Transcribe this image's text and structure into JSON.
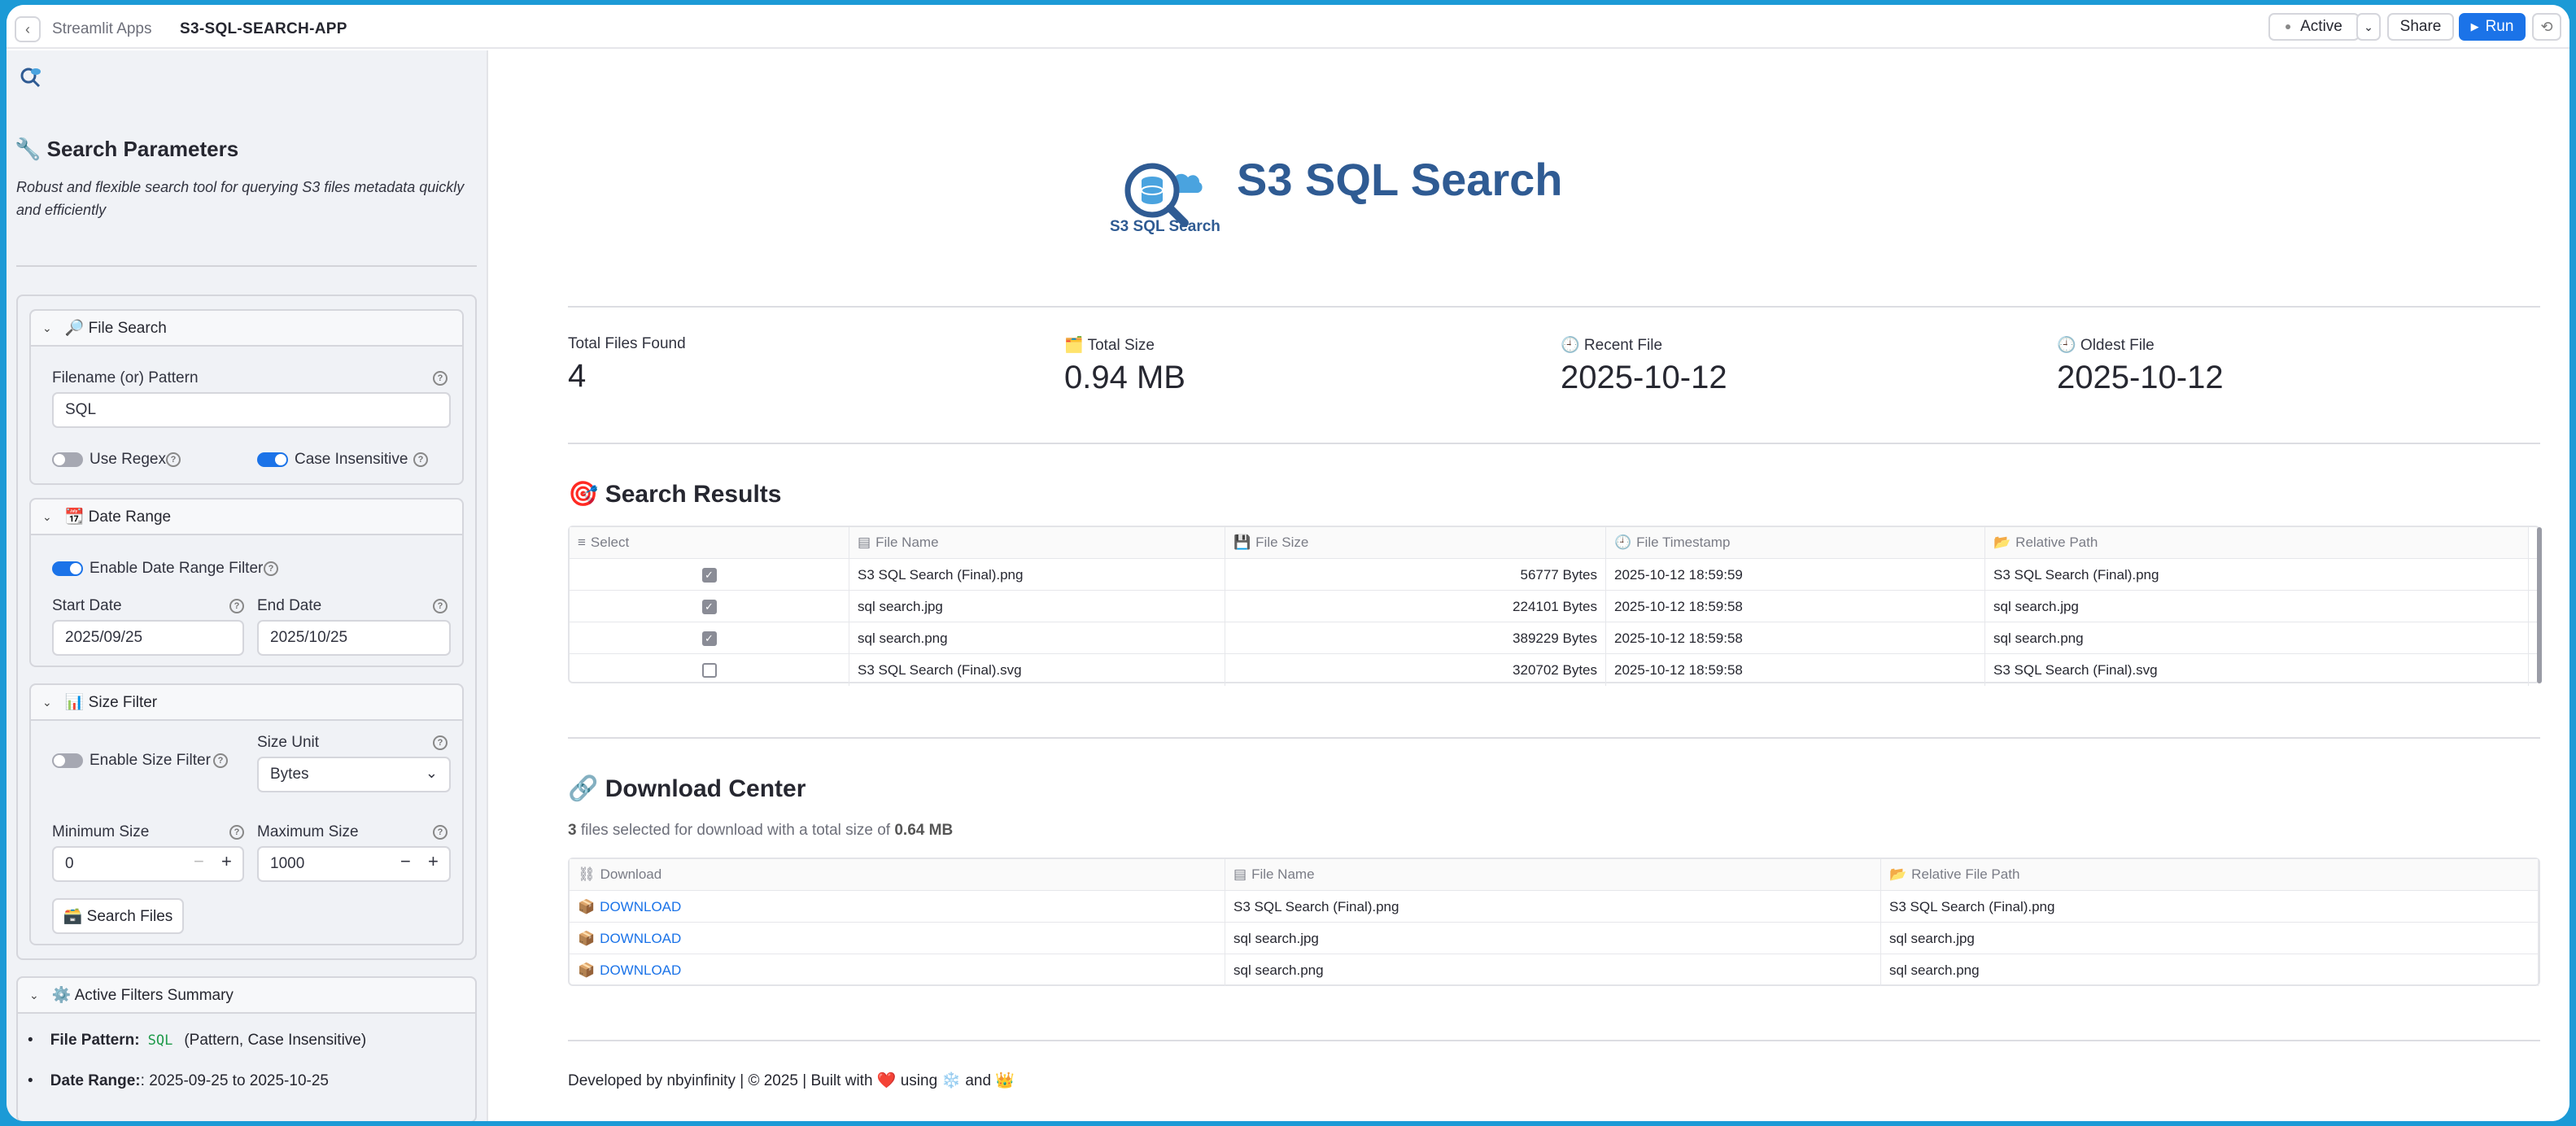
{
  "topbar": {
    "back_icon": "chevron-left-icon",
    "apps_label": "Streamlit Apps",
    "app_name": "S3-SQL-SEARCH-APP",
    "active_label": "Active",
    "share_label": "Share",
    "run_label": "Run",
    "reload_icon": "reload-icon"
  },
  "sidebar": {
    "title": "🔧 Search Parameters",
    "description": "Robust and flexible search tool for querying S3 files metadata quickly and efficiently",
    "file_search": {
      "header": "🔎 File Search",
      "filename_label": "Filename (or) Pattern",
      "filename_value": "SQL",
      "use_regex_label": "Use Regex",
      "use_regex_on": false,
      "case_insensitive_label": "Case Insensitive",
      "case_insensitive_on": true
    },
    "date_range": {
      "header": "📆 Date Range",
      "enable_label": "Enable Date Range Filter",
      "enable_on": true,
      "start_label": "Start Date",
      "start_value": "2025/09/25",
      "end_label": "End Date",
      "end_value": "2025/10/25"
    },
    "size_filter": {
      "header": "📊 Size Filter",
      "enable_label": "Enable Size Filter",
      "enable_on": false,
      "unit_label": "Size Unit",
      "unit_value": "Bytes",
      "min_label": "Minimum Size",
      "min_value": "0",
      "max_label": "Maximum Size",
      "max_value": "1000",
      "search_button": "🗃️ Search Files"
    },
    "summary": {
      "header": "⚙️ Active Filters Summary",
      "pattern_label": "File Pattern:",
      "pattern_value": "SQL",
      "pattern_note": "(Pattern, Case Insensitive)",
      "date_label": "Date Range:",
      "date_value": ": 2025-09-25 to 2025-10-25"
    }
  },
  "main": {
    "logo_text": "S3 SQL Search",
    "title": "S3 SQL Search",
    "metrics": [
      {
        "label": "Total Files Found",
        "value": "4"
      },
      {
        "label": "🗂️ Total Size",
        "value": "0.94 MB"
      },
      {
        "label": "🕘 Recent File",
        "value": "2025-10-12"
      },
      {
        "label": "🕘 Oldest File",
        "value": "2025-10-12"
      }
    ],
    "results_title": "🎯 Search Results",
    "results_headers": [
      "Select",
      "File Name",
      "File Size",
      "File Timestamp",
      "Relative Path"
    ],
    "results_rows": [
      {
        "selected": true,
        "name": "S3 SQL Search (Final).png",
        "size": "56777 Bytes",
        "ts": "2025-10-12 18:59:59",
        "path": "S3 SQL Search (Final).png"
      },
      {
        "selected": true,
        "name": "sql search.jpg",
        "size": "224101 Bytes",
        "ts": "2025-10-12 18:59:58",
        "path": "sql search.jpg"
      },
      {
        "selected": true,
        "name": "sql search.png",
        "size": "389229 Bytes",
        "ts": "2025-10-12 18:59:58",
        "path": "sql search.png"
      },
      {
        "selected": false,
        "name": "S3 SQL Search (Final).svg",
        "size": "320702 Bytes",
        "ts": "2025-10-12 18:59:58",
        "path": "S3 SQL Search (Final).svg"
      }
    ],
    "download_title": "🔗 Download Center",
    "download_note_count": "3",
    "download_note_mid": "files selected for download with a total size of",
    "download_note_size": "0.64 MB",
    "download_headers": [
      "Download",
      "File Name",
      "Relative File Path"
    ],
    "download_rows": [
      {
        "link": "DOWNLOAD",
        "name": "S3 SQL Search (Final).png",
        "path": "S3 SQL Search (Final).png"
      },
      {
        "link": "DOWNLOAD",
        "name": "sql search.jpg",
        "path": "sql search.jpg"
      },
      {
        "link": "DOWNLOAD",
        "name": "sql search.png",
        "path": "sql search.png"
      }
    ],
    "footer": "Developed by nbyinfinity | © 2025 | Built with ❤️ using ❄️ and 👑"
  }
}
